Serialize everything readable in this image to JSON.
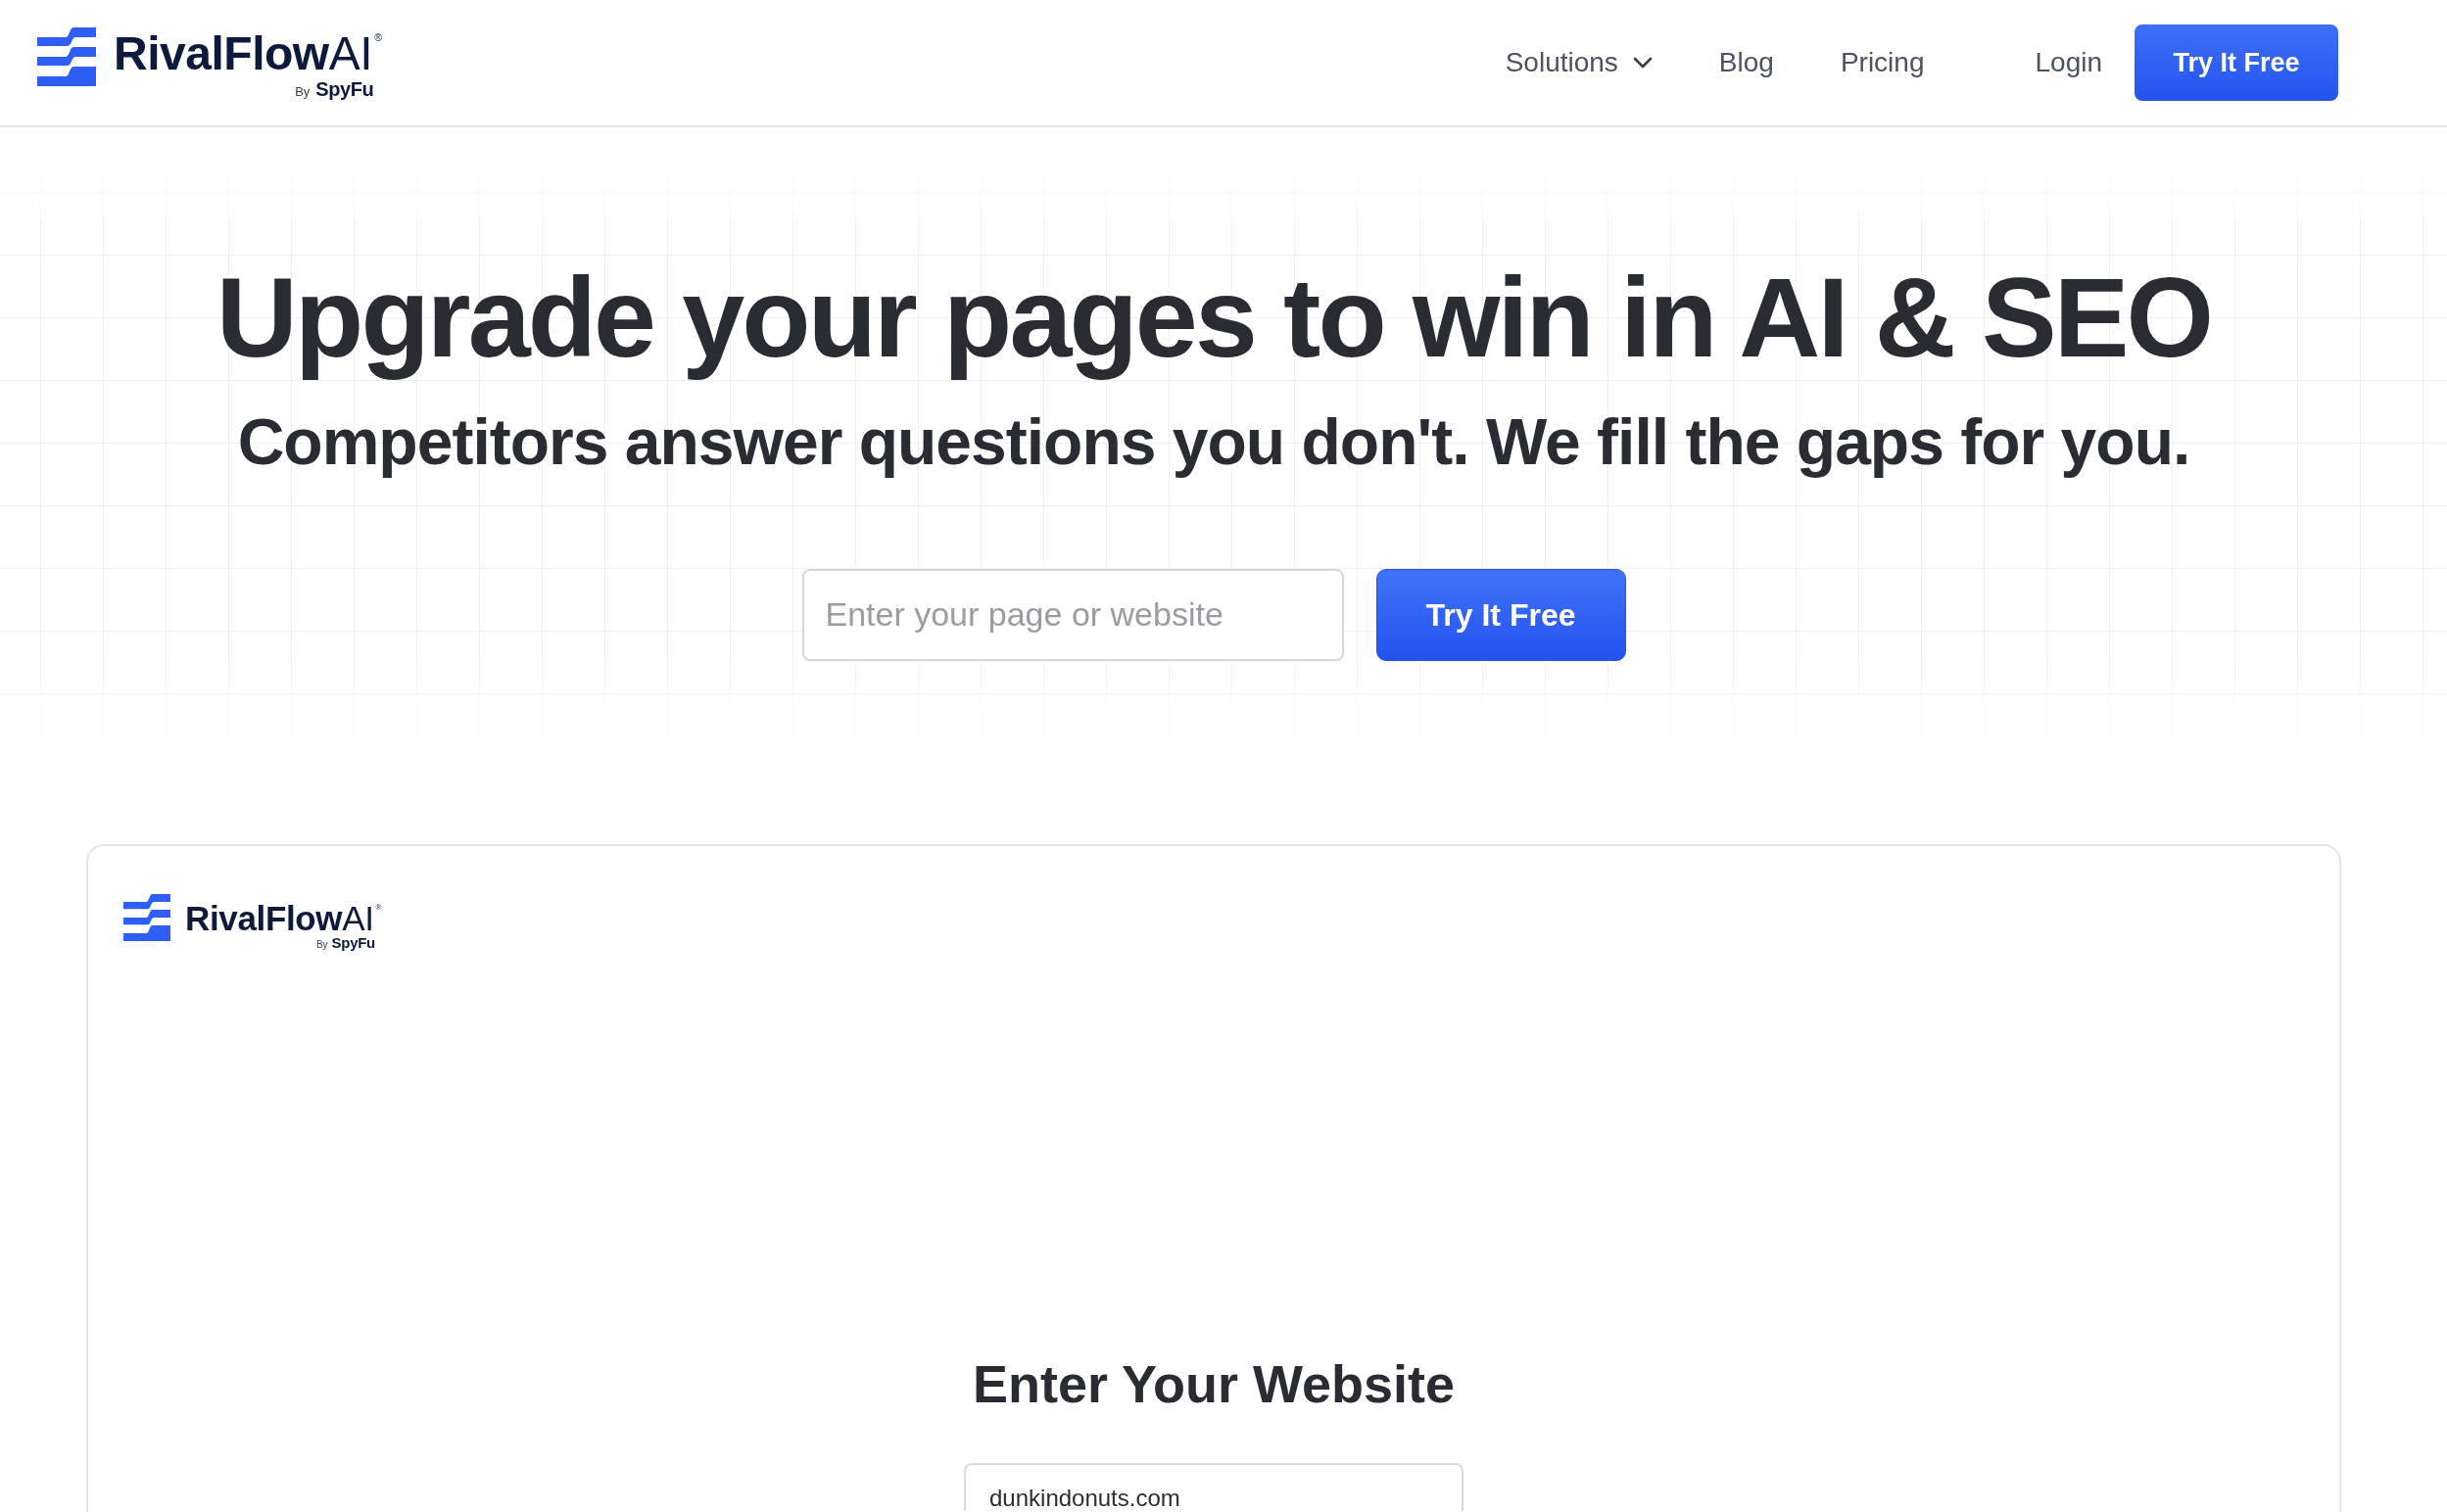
{
  "nav": {
    "logo": {
      "wordmark": "**RivalFlow**AI$^{®}$",
      "byline": "By",
      "parent_brand": "SpyFu"
    },
    "menu": [
      {
        "label": "Solutions",
        "kind": "dropdown"
      },
      {
        "label": "Blog",
        "kind": "link"
      },
      {
        "label": "Pricing",
        "kind": "link"
      }
    ],
    "login": "Login",
    "cta": "Try It Free"
  },
  "hero": {
    "title": "Upgrade your pages to win in AI & SEO",
    "subtitle": "Competitors answer questions you don't. We fill the gaps for you.",
    "input": {
      "placeholder": "Enter your page or website"
    },
    "button": "Try It Free"
  },
  "preview": {
    "logo": {
      "wordmark": "**RivalFlow**AI$^{®}$",
      "byline": "By",
      "parent_brand": "SpyFu"
    },
    "heading": "Enter Your Website",
    "input": {
      "value": "dunkindonuts.com"
    }
  }
}
